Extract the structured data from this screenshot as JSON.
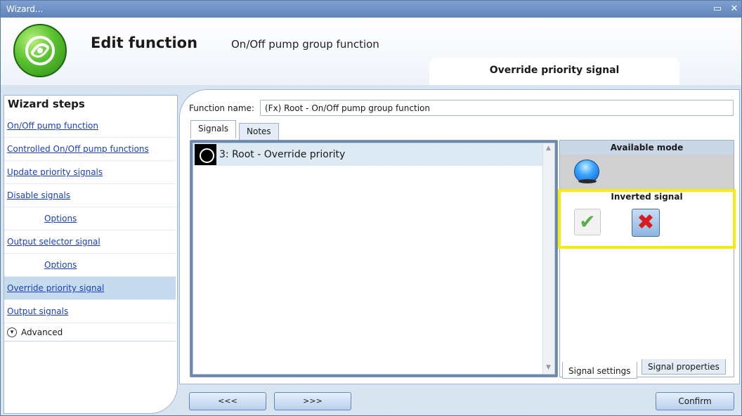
{
  "window": {
    "title": "Wizard..."
  },
  "header": {
    "title": "Edit function",
    "subtitle": "On/Off pump group function",
    "step_tab": "Override priority signal"
  },
  "sidebar": {
    "title": "Wizard steps",
    "items": [
      {
        "label": "On/Off pump function"
      },
      {
        "label": "Controlled On/Off pump functions"
      },
      {
        "label": "Update priority signals"
      },
      {
        "label": "Disable signals"
      },
      {
        "label": "Options"
      },
      {
        "label": "Output selector signal"
      },
      {
        "label": "Options"
      },
      {
        "label": "Override priority signal"
      },
      {
        "label": "Output signals"
      }
    ],
    "advanced": "Advanced"
  },
  "function_name": {
    "label": "Function name:",
    "value": "(Fx) Root - On/Off pump group function"
  },
  "tabs": [
    "Signals",
    "Notes"
  ],
  "signals": [
    {
      "label": "3: Root - Override priority"
    }
  ],
  "side_panel": {
    "available_mode": "Available mode",
    "inverted_signal": "Inverted signal",
    "tabs": [
      "Signal settings",
      "Signal properties"
    ]
  },
  "buttons": {
    "prev": "<<<",
    "next": ">>>",
    "confirm": "Confirm"
  },
  "colors": {
    "highlight": "#f6ea16",
    "link": "#1a3fbf",
    "active_step": "#c6dcee"
  }
}
